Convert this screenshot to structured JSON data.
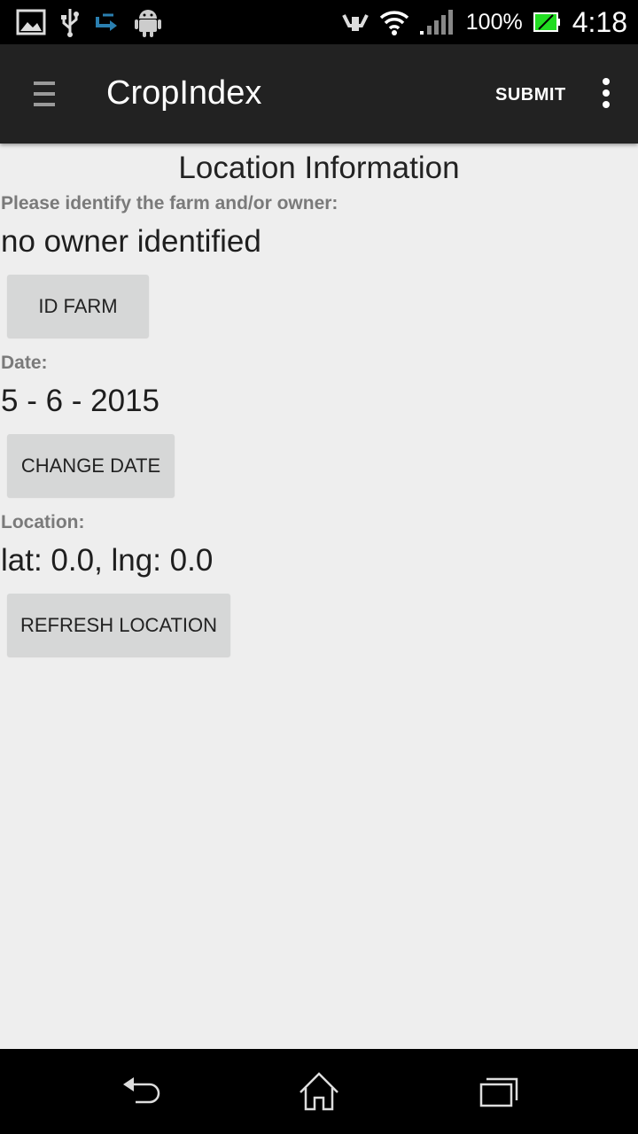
{
  "status_bar": {
    "battery_percent": "100%",
    "time": "4:18",
    "icons": [
      "gallery-icon",
      "usb-icon",
      "transfer-icon",
      "android-icon",
      "vibrate-icon",
      "wifi-icon",
      "signal-icon",
      "battery-icon"
    ]
  },
  "action_bar": {
    "title": "CropIndex",
    "submit_label": "SUBMIT"
  },
  "content": {
    "title": "Location Information",
    "farm_prompt": "Please identify the farm and/or owner:",
    "owner_value": "no owner identified",
    "id_farm_button": "ID FARM",
    "date_label": "Date:",
    "date_value": "5 - 6 - 2015",
    "change_date_button": "CHANGE DATE",
    "location_label": "Location:",
    "location_value": "lat: 0.0, lng: 0.0",
    "refresh_location_button": "REFRESH LOCATION"
  },
  "nav_bar": {
    "icons": [
      "back-icon",
      "home-icon",
      "recents-icon"
    ]
  }
}
